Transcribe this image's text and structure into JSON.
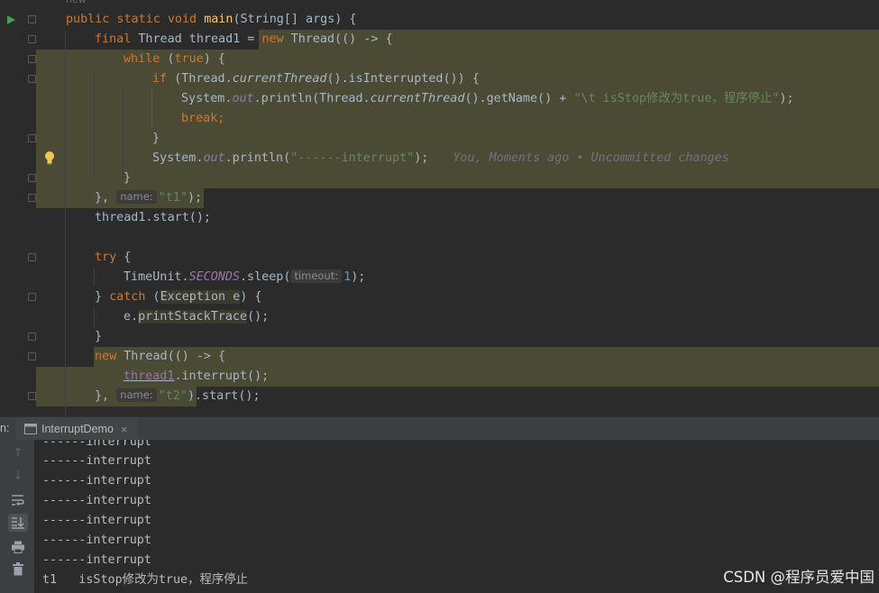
{
  "code": {
    "top_hint": "new",
    "main_sig": {
      "kw": "public static void ",
      "fn": "main",
      "rest": "(String[] args) {"
    },
    "thread1_decl": {
      "kw": "final",
      "type": " Thread thread1 = ",
      "new": "new",
      "rest": " Thread(() -> {"
    },
    "while_line": {
      "kw": "while",
      "p1": " (",
      "val": "true",
      "p2": ") {"
    },
    "if_line": {
      "kw": "if",
      "p1": " (Thread.",
      "m": "currentThread",
      "p2": "().isInterrupted()) {"
    },
    "println1": {
      "a": "System.",
      "out": "out",
      "b": ".println(Thread.",
      "m": "currentThread",
      "c": "().getName() + ",
      "str": "\"\\t isStop修改为true，程序停止\"",
      "d": ");"
    },
    "break_line": "break;",
    "close_brace": "}",
    "println2": {
      "a": "System.",
      "out": "out",
      "b": ".println(",
      "str": "\"------interrupt\"",
      "c": ");",
      "blame": "You, Moments ago • Uncommitted changes"
    },
    "thread1_end": {
      "a": "}, ",
      "hint": "name:",
      "str": "\"t1\"",
      "b": ");"
    },
    "start1": "thread1.start();",
    "try_line": {
      "kw": "try",
      "rest": " {"
    },
    "sleep_line": {
      "a": "TimeUnit.",
      "fld": "SECONDS",
      "b": ".sleep(",
      "hint": "timeout:",
      "num": "1",
      "c": ");"
    },
    "catch_line": {
      "a": "} ",
      "kw": "catch",
      "b": " (",
      "exc": "Exception e",
      "c": ") {"
    },
    "trace_line": {
      "a": "e.",
      "m": "printStackTrace",
      "b": "();"
    },
    "new_thread2": {
      "kw": "new",
      "rest": " Thread(() -> {"
    },
    "interrupt_line": {
      "var": "thread1",
      "rest": ".interrupt();"
    },
    "thread2_end": {
      "a": "}, ",
      "hint": "name:",
      "str": "\"t2\"",
      "b": ").start();"
    }
  },
  "run_panel": {
    "label": "n:",
    "tab_name": "InterruptDemo",
    "close": "×"
  },
  "console": {
    "lines": [
      "------interrupt",
      "------interrupt",
      "------interrupt",
      "------interrupt",
      "------interrupt",
      "------interrupt",
      "------interrupt"
    ],
    "last_line": "t1   isStop修改为true，程序停止"
  },
  "watermark": "CSDN @程序员爱中国"
}
